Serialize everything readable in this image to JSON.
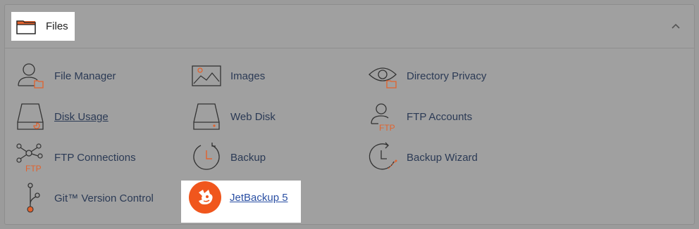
{
  "section": {
    "title": "Files",
    "icon": "folder-icon",
    "collapse_icon": "chevron-up-icon"
  },
  "items": [
    {
      "label": "File Manager",
      "icon": "file-manager-icon"
    },
    {
      "label": "Images",
      "icon": "images-icon"
    },
    {
      "label": "Directory Privacy",
      "icon": "directory-privacy-icon"
    },
    {
      "label": "Disk Usage",
      "icon": "disk-usage-icon"
    },
    {
      "label": "Web Disk",
      "icon": "web-disk-icon"
    },
    {
      "label": "FTP Accounts",
      "icon": "ftp-accounts-icon"
    },
    {
      "label": "FTP Connections",
      "icon": "ftp-connections-icon"
    },
    {
      "label": "Backup",
      "icon": "backup-icon"
    },
    {
      "label": "Backup Wizard",
      "icon": "backup-wizard-icon"
    },
    {
      "label": "Git™ Version Control",
      "icon": "git-icon"
    },
    {
      "label": "JetBackup 5",
      "icon": "jetbackup-logo-icon"
    }
  ],
  "icon_texts": {
    "ftp": "FTP"
  },
  "colors": {
    "accent": "#e2622d",
    "link": "#2b3a55",
    "jet_orange": "#f0561d"
  }
}
